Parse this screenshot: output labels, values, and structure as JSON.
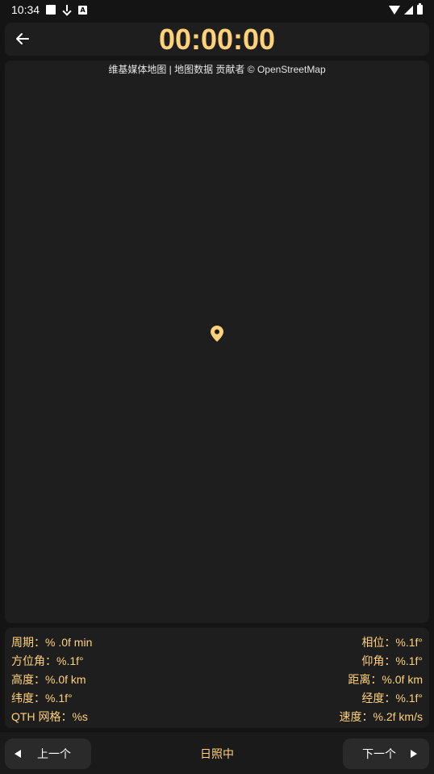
{
  "status_bar": {
    "time": "10:34",
    "icons": [
      "notification-square-icon",
      "download-icon",
      "a-icon",
      "wifi-icon",
      "signal-icon",
      "battery-icon"
    ]
  },
  "header": {
    "timer": "00:00:00"
  },
  "map": {
    "attribution": "维基媒体地图 | 地图数据 贡献者 © OpenStreetMap"
  },
  "info": {
    "rows": [
      {
        "left": "周期：% .0f min",
        "right": "相位：%.1f°"
      },
      {
        "left": "方位角：%.1f°",
        "right": "仰角：%.1f°"
      },
      {
        "left": "高度：%.0f km",
        "right": "距离：%.0f km"
      },
      {
        "left": "纬度：%.1f°",
        "right": "经度：%.1f°"
      },
      {
        "left": "QTH 网格：%s",
        "right": "速度：%.2f km/s"
      }
    ]
  },
  "bottom": {
    "prev_label": "上一个",
    "status": "日照中",
    "next_label": "下一个"
  },
  "colors": {
    "accent": "#ffd27a",
    "background": "#141414",
    "panel": "#1e1e1e",
    "button": "#2a2a2a"
  }
}
